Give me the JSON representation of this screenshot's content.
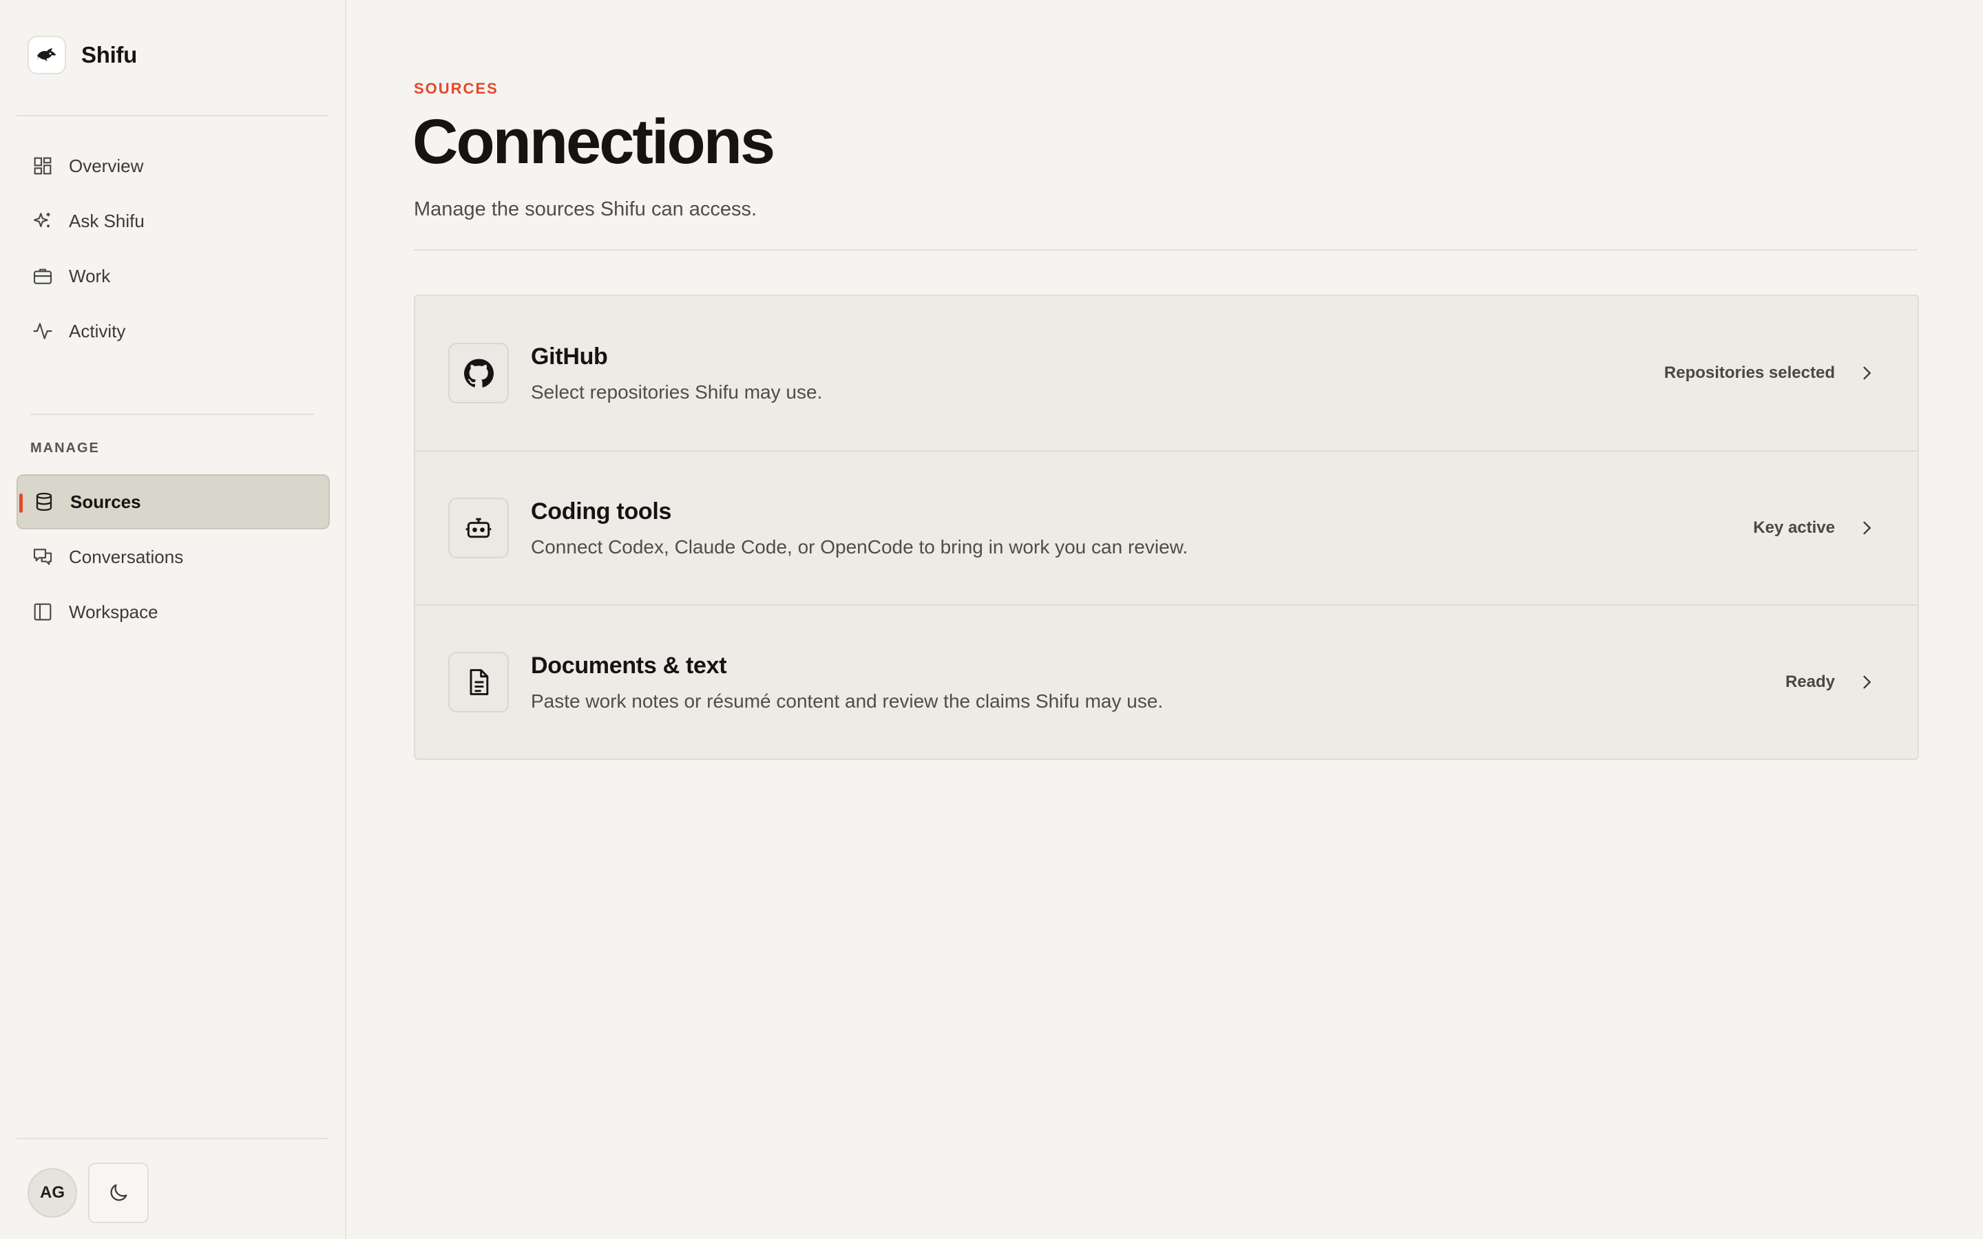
{
  "app": {
    "name": "Shifu",
    "logo_icon": "fish-logo-icon"
  },
  "sidebar": {
    "primary": [
      {
        "label": "Overview",
        "icon": "grid-icon"
      },
      {
        "label": "Ask Shifu",
        "icon": "sparkle-icon"
      },
      {
        "label": "Work",
        "icon": "briefcase-icon"
      },
      {
        "label": "Activity",
        "icon": "pulse-icon"
      }
    ],
    "section_label": "MANAGE",
    "manage": [
      {
        "label": "Sources",
        "icon": "database-icon",
        "active": true
      },
      {
        "label": "Conversations",
        "icon": "chat-icon"
      },
      {
        "label": "Workspace",
        "icon": "panel-icon"
      }
    ],
    "user_initials": "AG",
    "theme_icon": "moon-icon"
  },
  "header": {
    "eyebrow": "SOURCES",
    "title": "Connections",
    "subtitle": "Manage the sources Shifu can access."
  },
  "connections": [
    {
      "title": "GitHub",
      "description": "Select repositories Shifu may use.",
      "status": "Repositories selected",
      "icon": "github-icon"
    },
    {
      "title": "Coding tools",
      "description": "Connect Codex, Claude Code, or OpenCode to bring in work you can review.",
      "status": "Key active",
      "icon": "bot-icon"
    },
    {
      "title": "Documents & text",
      "description": "Paste work notes or résumé content and review the claims Shifu may use.",
      "status": "Ready",
      "icon": "document-icon"
    }
  ],
  "colors": {
    "accent": "#e5482b",
    "active_bg": "#d9d6cb",
    "background": "#f5f4f0"
  }
}
